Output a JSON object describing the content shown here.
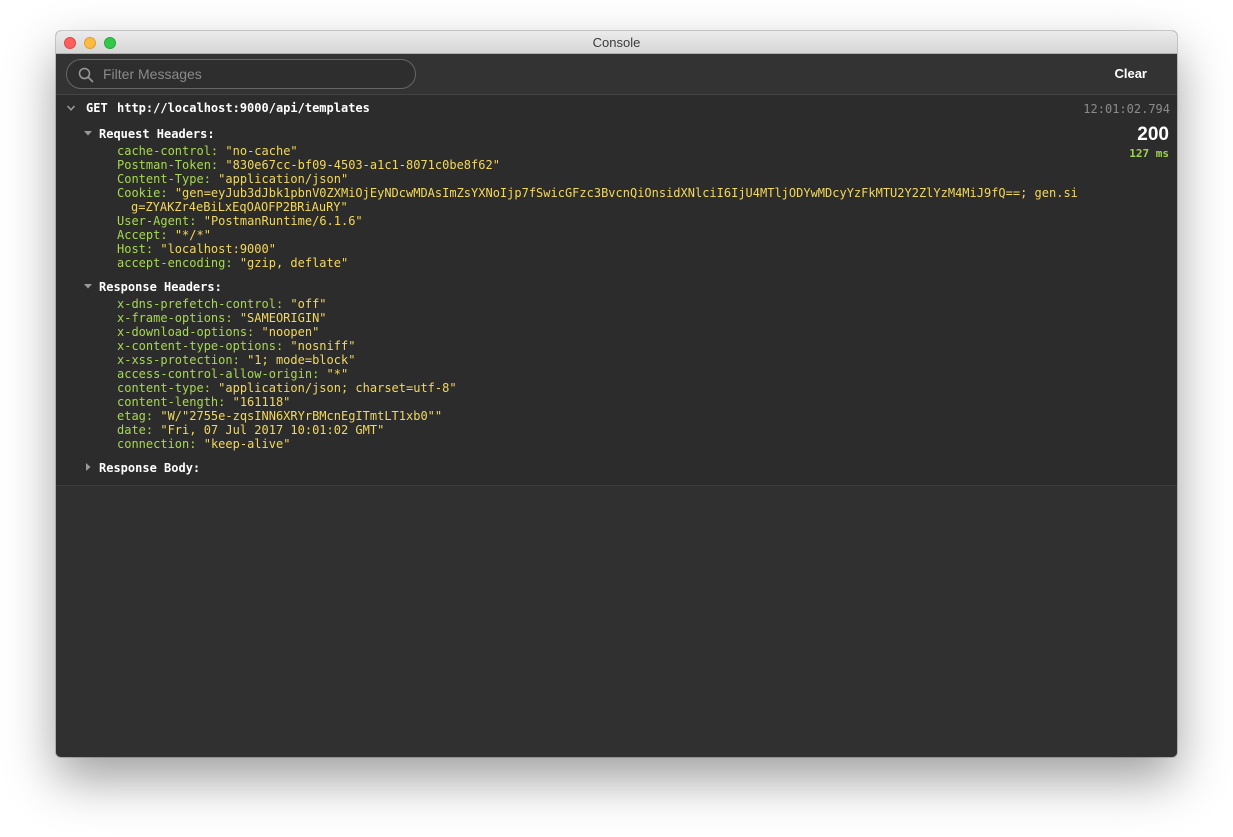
{
  "window": {
    "title": "Console"
  },
  "toolbar": {
    "search_placeholder": "Filter Messages",
    "clear_label": "Clear"
  },
  "request": {
    "method": "GET",
    "url": "http://localhost:9000/api/templates",
    "timestamp": "12:01:02.794",
    "status": "200",
    "duration": "127 ms"
  },
  "request_headers": {
    "label": "Request Headers:",
    "items": [
      {
        "key": "cache-control:",
        "value": "\"no-cache\""
      },
      {
        "key": "Postman-Token:",
        "value": "\"830e67cc-bf09-4503-a1c1-8071c0be8f62\""
      },
      {
        "key": "Content-Type:",
        "value": "\"application/json\""
      },
      {
        "key": "Cookie:",
        "value": "\"gen=eyJub3dJbk1pbnV0ZXMiOjEyNDcwMDAsImZsYXNoIjp7fSwicGFzc3BvcnQiOnsidXNlciI6IjU4MTljODYwMDcyYzFkMTU2Y2ZlYzM4MiJ9fQ==; gen.si",
        "value_cont": "g=ZYAKZr4eBiLxEqOAOFP2BRiAuRY\""
      },
      {
        "key": "User-Agent:",
        "value": "\"PostmanRuntime/6.1.6\""
      },
      {
        "key": "Accept:",
        "value": "\"*/*\""
      },
      {
        "key": "Host:",
        "value": "\"localhost:9000\""
      },
      {
        "key": "accept-encoding:",
        "value": "\"gzip, deflate\""
      }
    ]
  },
  "response_headers": {
    "label": "Response Headers:",
    "items": [
      {
        "key": "x-dns-prefetch-control:",
        "value": "\"off\""
      },
      {
        "key": "x-frame-options:",
        "value": "\"SAMEORIGIN\""
      },
      {
        "key": "x-download-options:",
        "value": "\"noopen\""
      },
      {
        "key": "x-content-type-options:",
        "value": "\"nosniff\""
      },
      {
        "key": "x-xss-protection:",
        "value": "\"1; mode=block\""
      },
      {
        "key": "access-control-allow-origin:",
        "value": "\"*\""
      },
      {
        "key": "content-type:",
        "value": "\"application/json; charset=utf-8\""
      },
      {
        "key": "content-length:",
        "value": "\"161118\""
      },
      {
        "key": "etag:",
        "value": "\"W/\"2755e-zqsINN6XRYrBMcnEgITmtLT1xb0\"\""
      },
      {
        "key": "date:",
        "value": "\"Fri, 07 Jul 2017 10:01:02 GMT\""
      },
      {
        "key": "connection:",
        "value": "\"keep-alive\""
      }
    ]
  },
  "response_body": {
    "label": "Response Body:"
  },
  "colors": {
    "key": "#a6d94f",
    "value": "#f2d85c",
    "duration": "#9fd34d",
    "background": "#2c2c2c"
  }
}
